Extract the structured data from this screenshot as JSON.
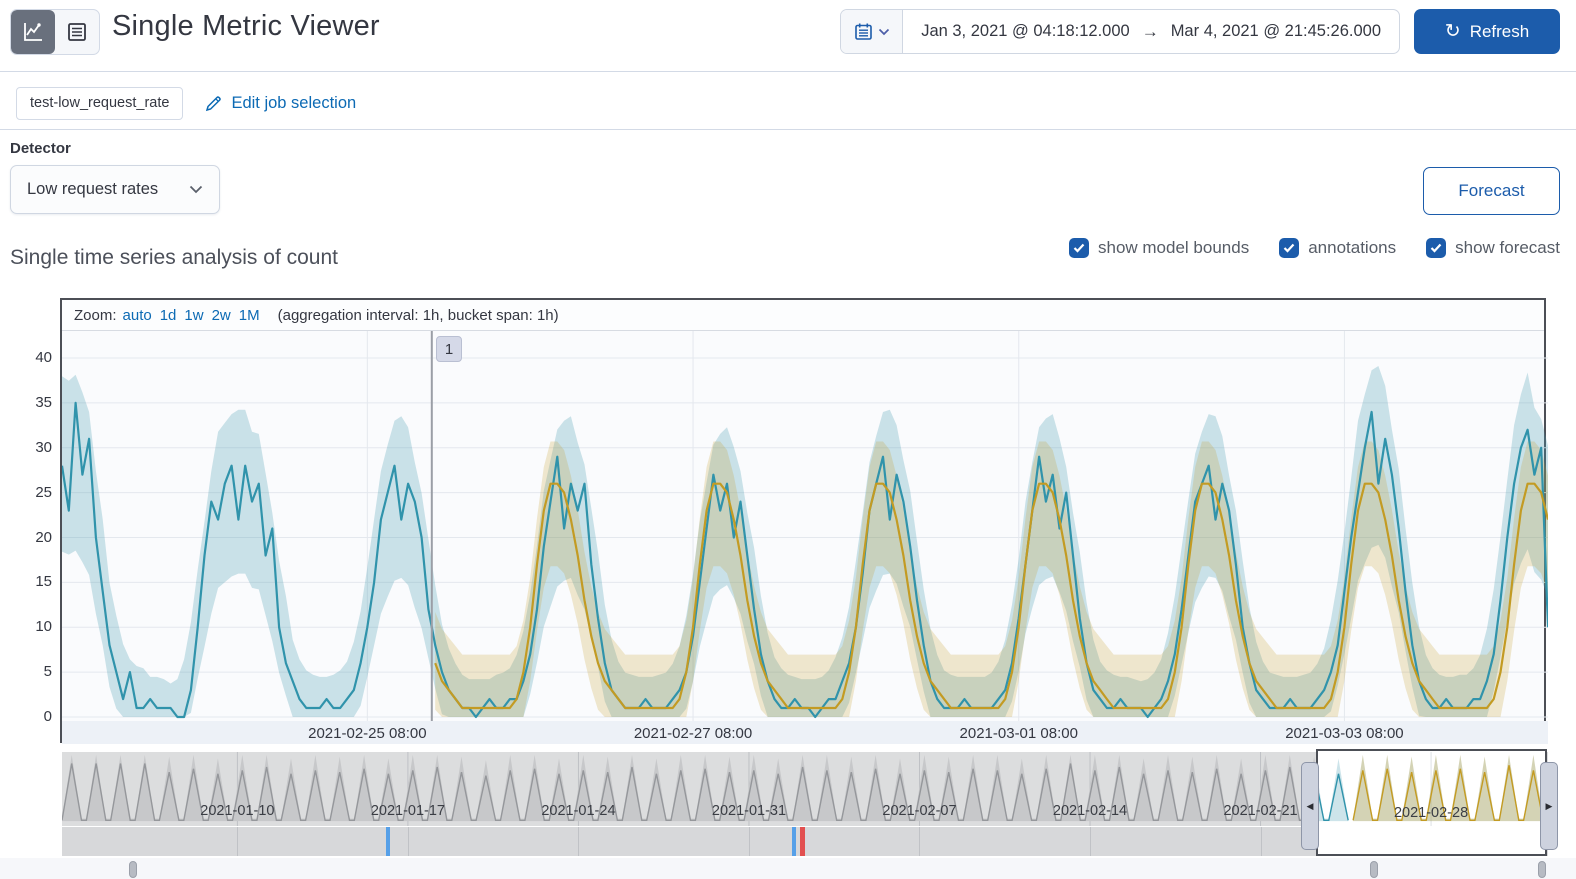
{
  "header": {
    "title": "Single Metric Viewer",
    "refresh_label": "Refresh",
    "time_range": {
      "start": "Jan 3, 2021 @ 04:18:12.000",
      "end": "Mar 4, 2021 @ 21:45:26.000"
    }
  },
  "job_bar": {
    "job_badge": "test-low_request_rate",
    "edit_link": "Edit job selection"
  },
  "detector": {
    "label": "Detector",
    "selected": "Low request rates"
  },
  "forecast_button": "Forecast",
  "series_header": {
    "title": "Single time series analysis of count",
    "checkboxes": [
      {
        "label": "show model bounds",
        "checked": true
      },
      {
        "label": "annotations",
        "checked": true
      },
      {
        "label": "show forecast",
        "checked": true
      }
    ]
  },
  "zoom_bar": {
    "prefix": "Zoom:",
    "options": [
      "auto",
      "1d",
      "1w",
      "2w",
      "1M"
    ],
    "suffix": "(aggregation interval: 1h, bucket span: 1h)"
  },
  "colors": {
    "accent": "#1c5cab",
    "link": "#0c6ab4",
    "actual_line": "#3093ab",
    "model_band": "rgba(77,157,178,0.28)",
    "forecast_line": "#c39b23",
    "forecast_band": "rgba(195,155,35,0.22)",
    "grid": "#e4e8ee",
    "annotation_line": "#9a9ea6",
    "context_line": "#95979b",
    "context_band": "#c7c8ca",
    "context_grid": "#bfc1c5",
    "anomaly_red": "#e25050",
    "annotation_blue": "#56a0e8"
  },
  "chart_data": {
    "type": "line",
    "main": {
      "ylabel": "count",
      "yticks": [
        0,
        5,
        10,
        15,
        20,
        25,
        30,
        35,
        40
      ],
      "ylim": [
        0,
        43
      ],
      "xticks": [
        {
          "label": "2021-02-25 08:00",
          "index": 45
        },
        {
          "label": "2021-02-27 08:00",
          "index": 93
        },
        {
          "label": "2021-03-01 08:00",
          "index": 141
        },
        {
          "label": "2021-03-03 08:00",
          "index": 189
        }
      ],
      "annotation_label": "1",
      "annotation_index": 54.5,
      "actual": [
        28,
        23,
        35,
        27,
        31,
        20,
        14,
        8,
        5,
        2,
        5,
        1,
        1,
        2,
        1,
        1,
        1,
        0,
        0,
        3,
        10,
        18,
        24,
        22,
        26,
        28,
        22,
        28,
        24,
        26,
        18,
        21,
        10,
        6,
        4,
        2,
        1,
        1,
        1,
        2,
        1,
        1,
        2,
        3,
        6,
        10,
        15,
        22,
        25,
        28,
        22,
        26,
        24,
        20,
        12,
        8,
        5,
        3,
        2,
        1,
        1,
        0,
        1,
        2,
        1,
        1,
        2,
        2,
        4,
        7,
        12,
        19,
        24,
        29,
        21,
        26,
        23,
        26,
        17,
        11,
        6,
        3,
        2,
        1,
        1,
        1,
        2,
        1,
        1,
        1,
        2,
        3,
        5,
        9,
        15,
        21,
        27,
        23,
        26,
        20,
        24,
        18,
        12,
        7,
        4,
        2,
        1,
        1,
        2,
        1,
        1,
        0,
        1,
        2,
        2,
        4,
        6,
        10,
        16,
        23,
        26,
        29,
        22,
        27,
        24,
        19,
        13,
        8,
        4,
        2,
        1,
        1,
        1,
        2,
        1,
        1,
        1,
        1,
        2,
        3,
        6,
        11,
        17,
        23,
        29,
        24,
        27,
        21,
        25,
        18,
        11,
        6,
        3,
        2,
        1,
        1,
        2,
        1,
        1,
        1,
        0,
        1,
        2,
        4,
        7,
        12,
        18,
        24,
        26,
        28,
        22,
        26,
        23,
        17,
        10,
        6,
        3,
        2,
        1,
        1,
        1,
        2,
        1,
        1,
        1,
        2,
        3,
        5,
        8,
        14,
        20,
        25,
        30,
        34,
        26,
        31,
        27,
        21,
        14,
        8,
        4,
        2,
        1,
        1,
        2,
        1,
        1,
        1,
        2,
        2,
        4,
        7,
        13,
        20,
        26,
        30,
        32,
        27,
        30,
        10
      ],
      "forecast": {
        "start_index": 55,
        "day_pattern": [
          26,
          26,
          25,
          22,
          18,
          13,
          9,
          6,
          4,
          3,
          2,
          1,
          1,
          1,
          1,
          1,
          1,
          1,
          1,
          2,
          5,
          10,
          17,
          23
        ]
      }
    },
    "context": {
      "days": 61,
      "labels": [
        {
          "label": "2021-01-10",
          "day": 7
        },
        {
          "label": "2021-01-17",
          "day": 14
        },
        {
          "label": "2021-01-24",
          "day": 21
        },
        {
          "label": "2021-01-31",
          "day": 28
        },
        {
          "label": "2021-02-07",
          "day": 35
        },
        {
          "label": "2021-02-14",
          "day": 42
        },
        {
          "label": "2021-02-21",
          "day": 49
        },
        {
          "label": "2021-02-28",
          "day": 56
        }
      ],
      "peaks": [
        60,
        60,
        60,
        60,
        29,
        31,
        28,
        30,
        32,
        28,
        30,
        29,
        31,
        28,
        30,
        32,
        29,
        27,
        30,
        31,
        28,
        30,
        29,
        32,
        28,
        30,
        31,
        29,
        30,
        28,
        32,
        30,
        29,
        31,
        28,
        30,
        29,
        31,
        30,
        28,
        31,
        40,
        30,
        32,
        28,
        30,
        29,
        31,
        28,
        30,
        32,
        29,
        28,
        30,
        31,
        29,
        30,
        31,
        29,
        33,
        30
      ],
      "swimlane_markers": [
        {
          "day": 13.3,
          "kind": "annotation-blue"
        },
        {
          "day": 29.95,
          "kind": "annotation-blue"
        },
        {
          "day": 30.28,
          "kind": "anomaly-red"
        }
      ],
      "brush": {
        "start_day": 51.5,
        "end_day": 60.9,
        "forecast_from_day": 53,
        "label": "2021-02-28",
        "label_day": 56
      }
    }
  }
}
